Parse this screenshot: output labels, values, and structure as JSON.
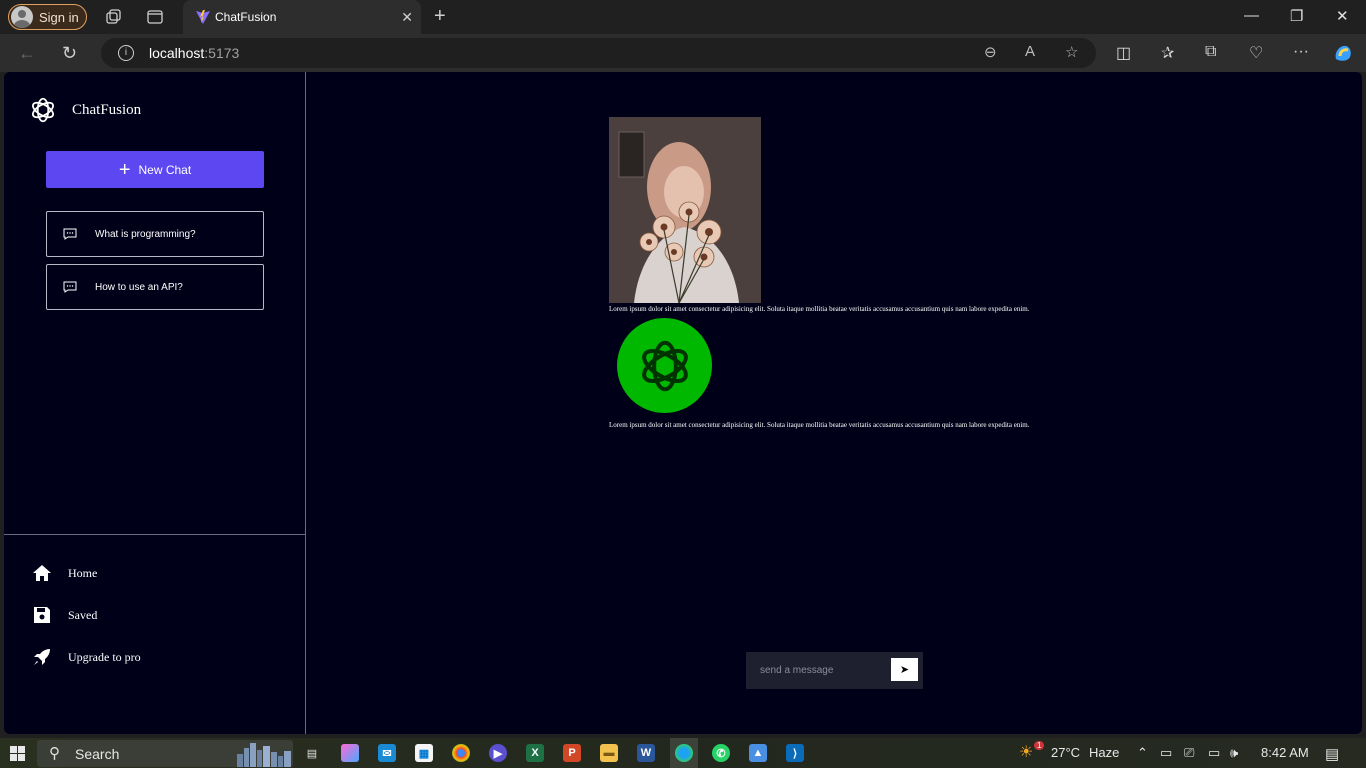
{
  "browser": {
    "signin_label": "Sign in",
    "tab_title": "ChatFusion",
    "url_host": "localhost",
    "url_port": ":5173"
  },
  "sidebar": {
    "brand": "ChatFusion",
    "new_chat_label": "New Chat",
    "history": [
      {
        "label": "What is programming?"
      },
      {
        "label": "How to use an API?"
      }
    ],
    "nav": [
      {
        "label": "Home",
        "icon": "home-icon"
      },
      {
        "label": "Saved",
        "icon": "save-icon"
      },
      {
        "label": "Upgrade to pro",
        "icon": "rocket-icon"
      }
    ]
  },
  "chat": {
    "messages": [
      {
        "role": "user",
        "avatar": "user-photo",
        "text": "Lorem ipsum dolor sit amet consectetur adipisicing elit. Soluta itaque mollitia beatae veritatis accusamus accusantium quis nam labore expedita enim."
      },
      {
        "role": "bot",
        "avatar": "openai-logo-icon",
        "text": "Lorem ipsum dolor sit amet consectetur adipisicing elit. Soluta itaque mollitia beatae veritatis accusamus accusantium quis nam labore expedita enim."
      }
    ],
    "input_placeholder": "send a message",
    "send_label": "➤"
  },
  "taskbar": {
    "search_label": "Search",
    "weather_temp": "27°C",
    "weather_desc": "Haze",
    "weather_badge": "1",
    "time": "8:42 AM"
  },
  "colors": {
    "app_bg": "#000018",
    "accent": "#5c47f0",
    "bot_avatar": "#00b800"
  }
}
